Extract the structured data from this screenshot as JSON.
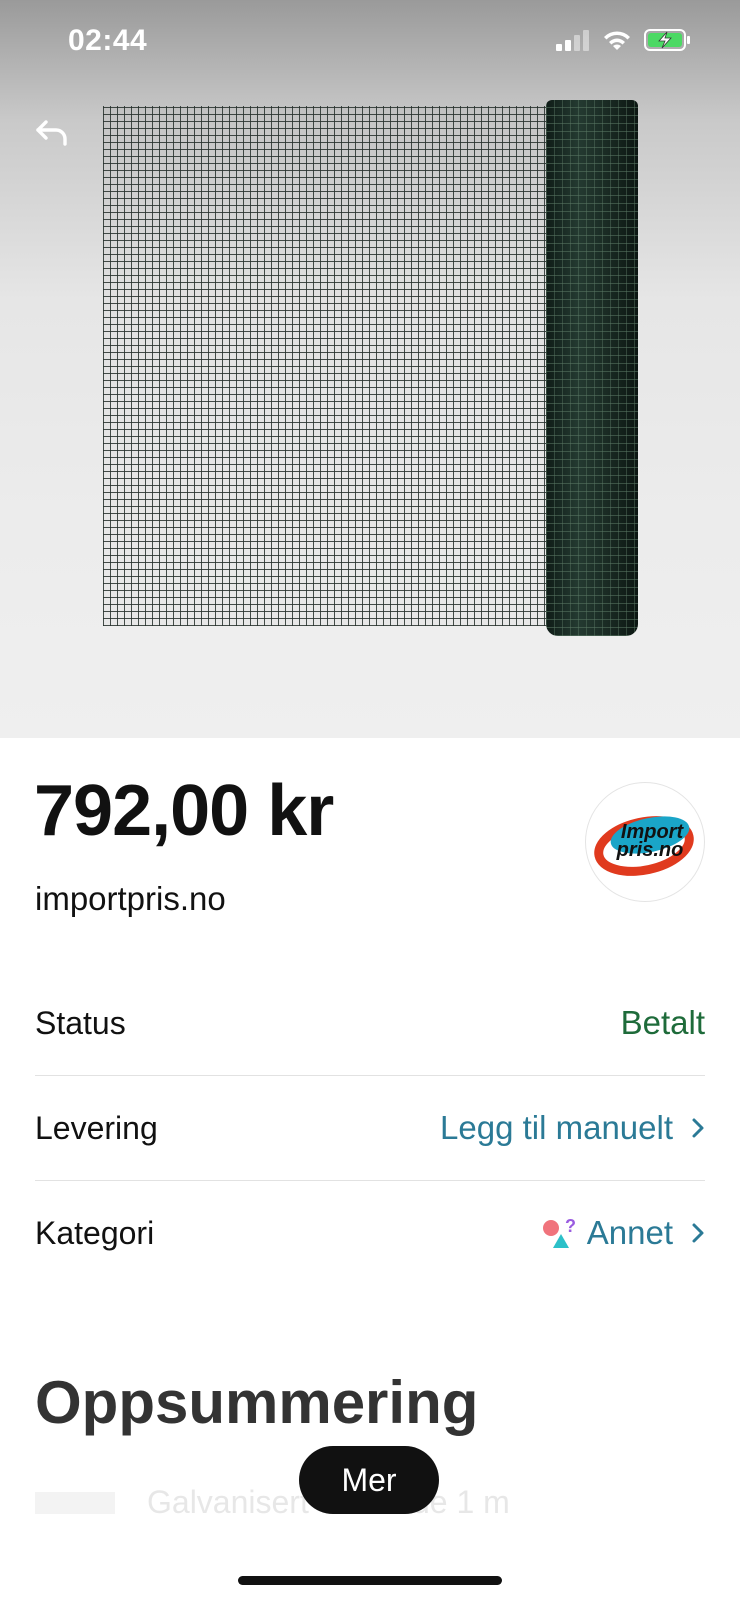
{
  "status_bar": {
    "time": "02:44",
    "icons": [
      "cellular-signal-icon",
      "wifi-icon",
      "battery-charging-icon"
    ]
  },
  "product": {
    "price": "792,00 kr",
    "shop": "importpris.no",
    "logo_text_line1": "Import",
    "logo_text_line2": "pris.no"
  },
  "details": {
    "status": {
      "label": "Status",
      "value": "Betalt"
    },
    "delivery": {
      "label": "Levering",
      "value": "Legg til manuelt"
    },
    "category": {
      "label": "Kategori",
      "value": "Annet",
      "icon": "shapes-icon"
    }
  },
  "summary": {
    "title": "Oppsummering",
    "first_item_partial": "Galvanisert … gjerde 1 m"
  },
  "more_button": "Mer",
  "colors": {
    "status_green": "#1e6b3a",
    "link_blue": "#2b7a96",
    "logo_red": "#e03a1e",
    "logo_teal": "#1aa5c8"
  }
}
